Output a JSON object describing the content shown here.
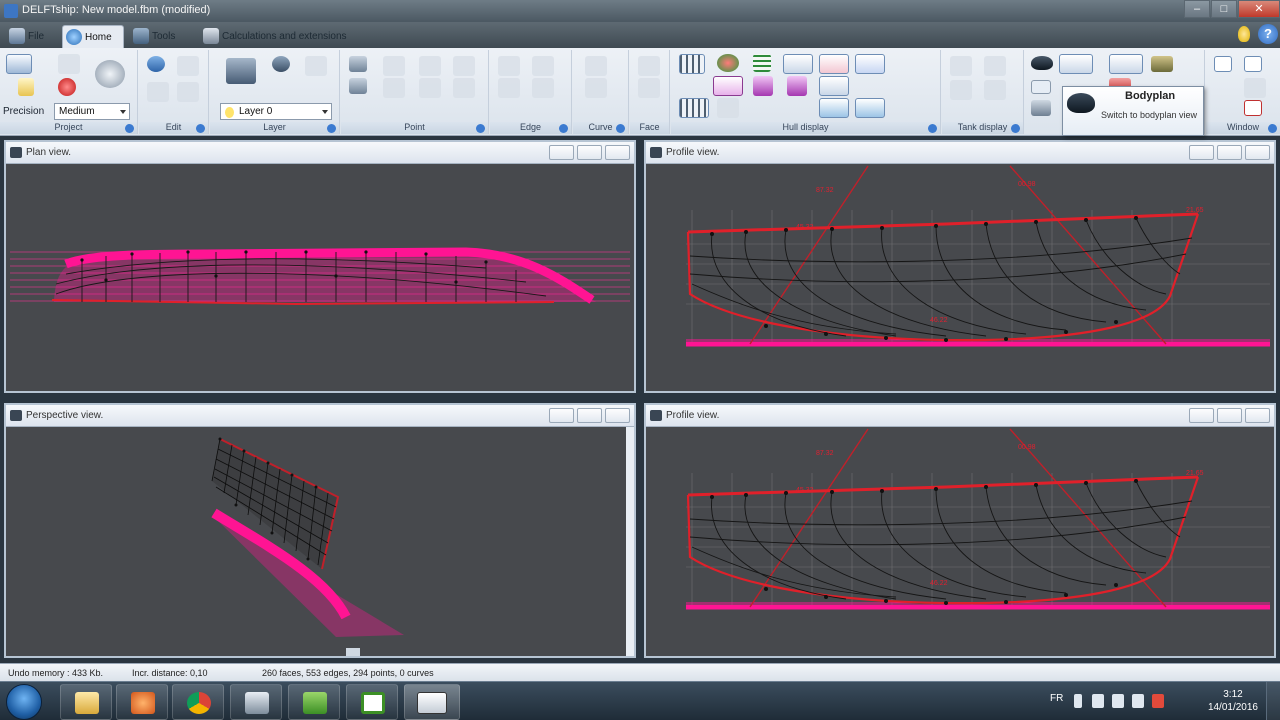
{
  "window": {
    "title": "DELFTship: New model.fbm (modified)"
  },
  "tabs": [
    {
      "label": "File",
      "icon": "file-menu-icon"
    },
    {
      "label": "Home",
      "icon": "home-tab-icon"
    },
    {
      "label": "Tools",
      "icon": "tools-tab-icon"
    },
    {
      "label": "Calculations and extensions",
      "icon": "calculator-icon"
    }
  ],
  "ribbon": {
    "precision_label": "Precision",
    "precision_value": "Medium",
    "layer_value": "Layer 0",
    "groups": [
      "Project",
      "Edit",
      "Layer",
      "Point",
      "Edge",
      "Curve",
      "Face",
      "Hull display",
      "Tank display",
      "Window"
    ]
  },
  "tooltip": {
    "title": "Bodyplan",
    "description": "Switch to bodyplan view"
  },
  "viewports": [
    {
      "title": "Plan view."
    },
    {
      "title": "Profile view."
    },
    {
      "title": "Perspective view."
    },
    {
      "title": "Profile view."
    }
  ],
  "profile_labels": [
    "87.32",
    "00.98",
    "45.32",
    "46.22",
    "21.65"
  ],
  "status": {
    "undo": "Undo memory : 433 Kb.",
    "incr": "Incr. distance: 0,10",
    "counts": "260 faces, 553 edges, 294 points, 0 curves"
  },
  "taskbar": {
    "items": [
      "file-explorer-icon",
      "media-player-icon",
      "chrome-icon",
      "app-window-icon",
      "camtasia-icon",
      "camtasia-recorder-icon",
      "delftship-icon"
    ],
    "lang": "FR",
    "time": "3:12",
    "date": "14/01/2016"
  },
  "colors": {
    "hull_magenta": "#ff1493",
    "hull_red": "#e0202a",
    "ribbon_bg": "#e8edf3",
    "viewport_bg": "#47494d"
  }
}
